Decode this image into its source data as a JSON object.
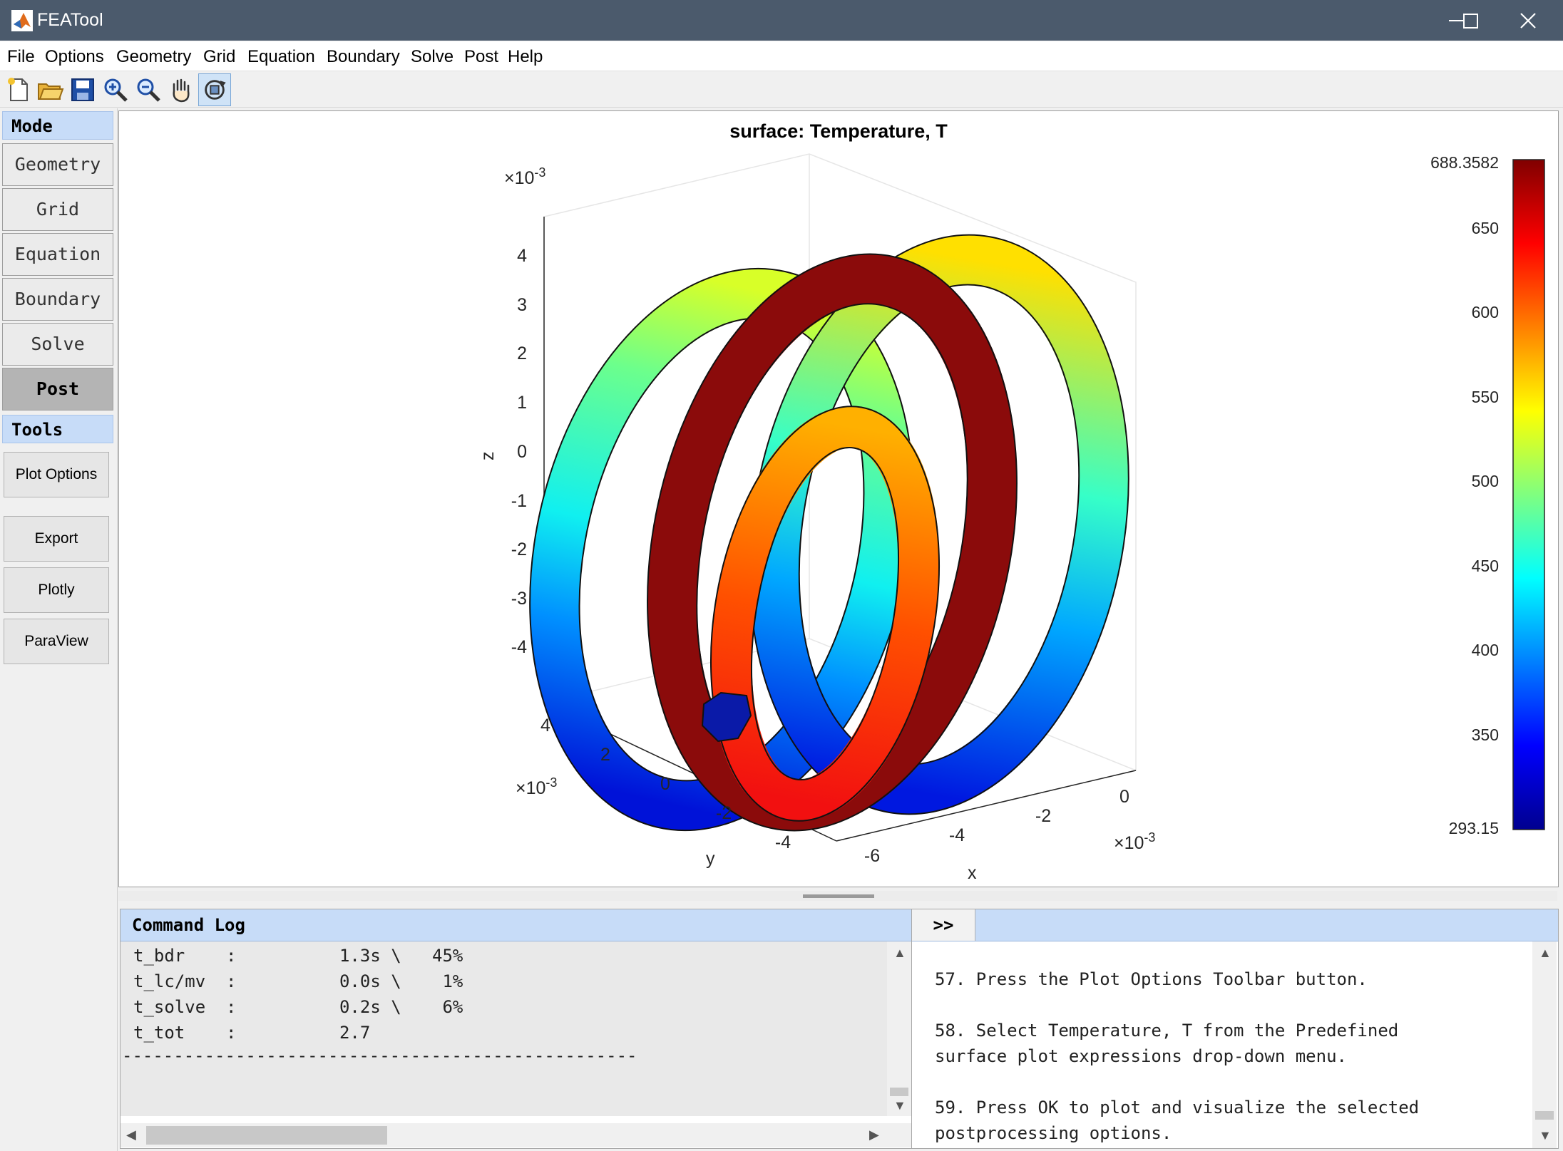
{
  "window": {
    "title": "FEATool"
  },
  "menu": [
    "File",
    "Options",
    "Geometry",
    "Grid",
    "Equation",
    "Boundary",
    "Solve",
    "Post",
    "Help"
  ],
  "toolbar_icons": [
    "new-file-icon",
    "open-folder-icon",
    "save-icon",
    "zoom-in-icon",
    "zoom-out-icon",
    "pan-hand-icon",
    "rotate-3d-icon"
  ],
  "sidebar": {
    "mode_header": "Mode",
    "modes": [
      "Geometry",
      "Grid",
      "Equation",
      "Boundary",
      "Solve",
      "Post"
    ],
    "active_mode": "Post",
    "tools_header": "Tools",
    "tools": [
      "Plot Options",
      "Export",
      "Plotly",
      "ParaView"
    ]
  },
  "plot": {
    "title": "surface: Temperature, T",
    "exponent_label": "×10",
    "exponent_power": "-3",
    "z_axis_label": "z",
    "x_axis_label": "x",
    "y_axis_label": "y",
    "z_ticks": [
      "4",
      "3",
      "2",
      "1",
      "0",
      "-1",
      "-2",
      "-3",
      "-4"
    ],
    "y_ticks": [
      "4",
      "2",
      "0",
      "-2",
      "-4"
    ],
    "x_ticks": [
      "-6",
      "-4",
      "-2",
      "0"
    ],
    "colorbar": {
      "colormap": "jet",
      "max_label": "688.3582",
      "min_label": "293.15",
      "ticks": [
        "650",
        "600",
        "550",
        "500",
        "450",
        "400",
        "350"
      ]
    }
  },
  "command_log": {
    "header": "Command Log",
    "lines": [
      "t_bdr    :          1.3s \\   45%",
      "t_lc/mv  :          0.0s \\    1%",
      "t_solve  :          0.2s \\    6%",
      "t_tot    :          2.7"
    ],
    "separator": "--------------------------------------------------"
  },
  "help_panel": {
    "toggle_label": ">>",
    "steps": [
      "57. Press the Plot Options Toolbar button.",
      "58. Select Temperature, T from the Predefined",
      "surface plot expressions drop-down menu.",
      "59. Press OK to plot and visualize the selected",
      "postprocessing options."
    ]
  }
}
